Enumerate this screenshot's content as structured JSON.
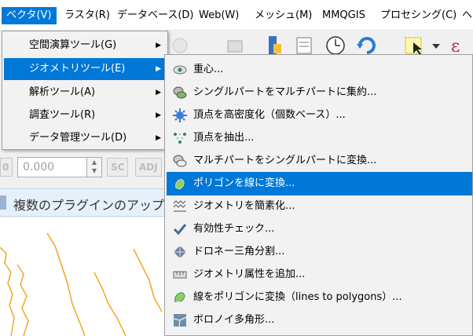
{
  "menubar": {
    "items": [
      {
        "label": "ベクタ(V)",
        "active": true
      },
      {
        "label": "ラスタ(R)"
      },
      {
        "label": "データベース(D)"
      },
      {
        "label": "Web(W)"
      },
      {
        "label": "メッシュ(M)"
      },
      {
        "label": "MMQGIS"
      },
      {
        "label": "プロセシング(C)"
      },
      {
        "label": "ヘ"
      }
    ]
  },
  "toolbar": {
    "spin_value": "0.000",
    "tags": [
      "SC",
      "ADJ"
    ],
    "left_tag": "0"
  },
  "message_bar": {
    "text": "複数のプラグインのアップデ"
  },
  "vector_menu": {
    "items": [
      {
        "label": "空間演算ツール(G)"
      },
      {
        "label": "ジオメトリツール(E)",
        "highlighted": true
      },
      {
        "label": "解析ツール(A)"
      },
      {
        "label": "調査ツール(R)"
      },
      {
        "label": "データ管理ツール(D)"
      }
    ],
    "arrow": "▶"
  },
  "geometry_submenu": {
    "items": [
      {
        "label": "重心...",
        "icon": "centroids-icon"
      },
      {
        "label": "シングルパートをマルチパートに集約...",
        "icon": "collect-geometries-icon"
      },
      {
        "label": "頂点を高密度化（個数ベース）...",
        "icon": "densify-icon"
      },
      {
        "label": "頂点を抽出...",
        "icon": "extract-vertices-icon"
      },
      {
        "label": "マルチパートをシングルパートに変換...",
        "icon": "multipart-to-single-icon"
      },
      {
        "label": "ポリゴンを線に変換...",
        "icon": "polygon-to-lines-icon",
        "highlighted": true
      },
      {
        "label": "ジオメトリを簡素化...",
        "icon": "simplify-icon"
      },
      {
        "label": "有効性チェック...",
        "icon": "check-validity-icon"
      },
      {
        "label": "ドロネー三角分割...",
        "icon": "delaunay-icon"
      },
      {
        "label": "ジオメトリ属性を追加...",
        "icon": "add-geometry-attributes-icon"
      },
      {
        "label": "線をポリゴンに変換（lines to polygons）...",
        "icon": "lines-to-polygons-icon"
      },
      {
        "label": "ボロノイ多角形...",
        "icon": "voronoi-icon"
      }
    ]
  },
  "colors": {
    "highlight": "#0078d7",
    "map_line": "#f5a623"
  }
}
